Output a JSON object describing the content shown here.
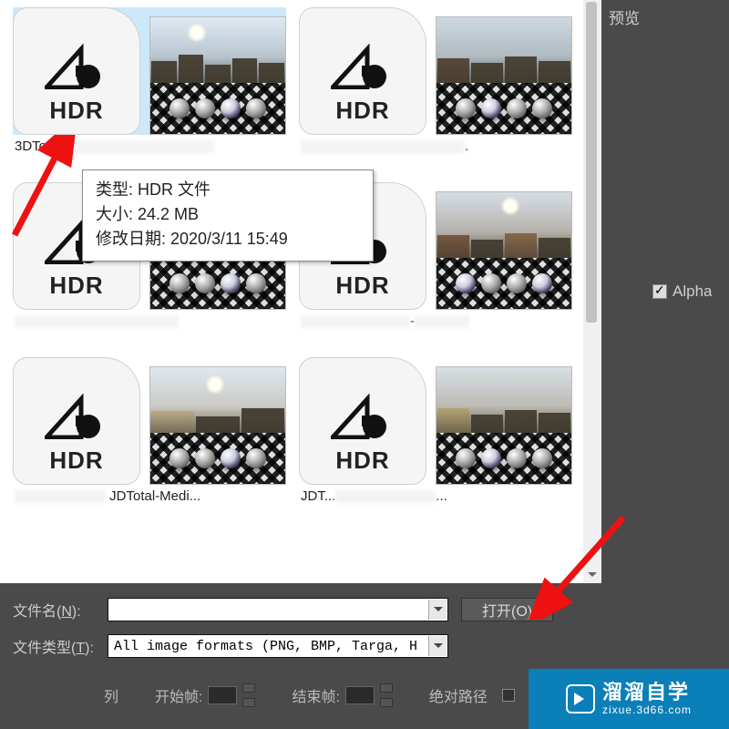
{
  "right_panel": {
    "preview_label": "预览",
    "alpha_label": "Alpha"
  },
  "tooltip": {
    "type_label": "类型: HDR 文件",
    "size_label": "大小: 24.2 MB",
    "date_label": "修改日期: 2020/3/11 15:49"
  },
  "files": {
    "hdr_icon_text": "HDR",
    "item1_name": "3DTot",
    "item4_name_mid": "-",
    "item5_name": "JDTotal-Medi...",
    "item6_name": "JDT..."
  },
  "form": {
    "filename_label": "文件名(",
    "filename_mn": "N",
    "filename_label_end": "):",
    "filetype_label": "文件类型(",
    "filetype_mn": "T",
    "filetype_label_end": "):",
    "filename_value": "",
    "filetype_value": "All image formats (PNG, BMP, Targa, H",
    "open_btn": "打开(O)"
  },
  "bottom": {
    "col_label": "列",
    "start_frame": "开始帧:",
    "end_frame": "结束帧:",
    "abs_path": "绝对路径"
  },
  "logo": {
    "cn": "溜溜自学",
    "en": "zixue.3d66.com"
  }
}
